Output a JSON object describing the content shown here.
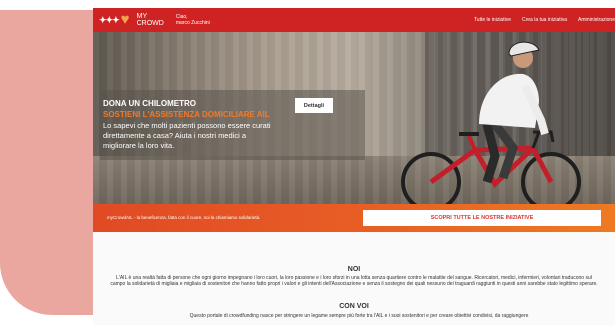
{
  "header": {
    "logo_text_line1": "MY",
    "logo_text_line2": "CROWD",
    "greeting_line1": "Ciao,",
    "greeting_line2": "marco Zucchini",
    "nav": [
      "Tutte le iniziative",
      "Crea la tua iniziativa",
      "Amministrazione"
    ]
  },
  "hero": {
    "title": "DONA UN CHILOMETRO",
    "subtitle": "SOSTIENI L'ASSISTENZA DOMICILIARE AIL",
    "text": "Lo sapevi che molti pazienti possono essere curati direttamente a casa? Aiuta i nostri medici a migliorare la loro vita.",
    "details_label": "Dettagli"
  },
  "banner": {
    "tagline": "myCrowdAIL - la beneficenza, fatta con il cuore, noi la chiamiamo solidarietà.",
    "discover_label": "SCOPRI TUTTE LE NOSTRE INIZIATIVE"
  },
  "about": {
    "noi_title": "NOI",
    "noi_text": "L'AIL è una realtà fatta di persone che ogni giorno impegnano i loro cuori, la loro passione e i loro sforzi in una lotta senza quartiere contro le malattie del sangue. Ricercatori, medici, infermieri, volontari traducono sul campo la solidarietà di migliaia e migliaia di sostenitori che hanno fatto propri i valori e gli intenti dell'Associazione e senza il sostegno dei quali nessuno dei traguardi raggiunti in questi anni sarebbe stato legittimo sperare.",
    "convoi_title": "CON VOI",
    "convoi_text": "Questo portale di crowdfunding nasce per stringere un legame sempre più forte tra l'AIL e i suoi sostenitori e per creare obiettivi condivisi, da raggiungere"
  },
  "colors": {
    "brand_red": "#cf2323",
    "accent_orange": "#e85d25",
    "subtitle_orange": "#f07a2a",
    "side_pink": "#e9a7a0"
  }
}
